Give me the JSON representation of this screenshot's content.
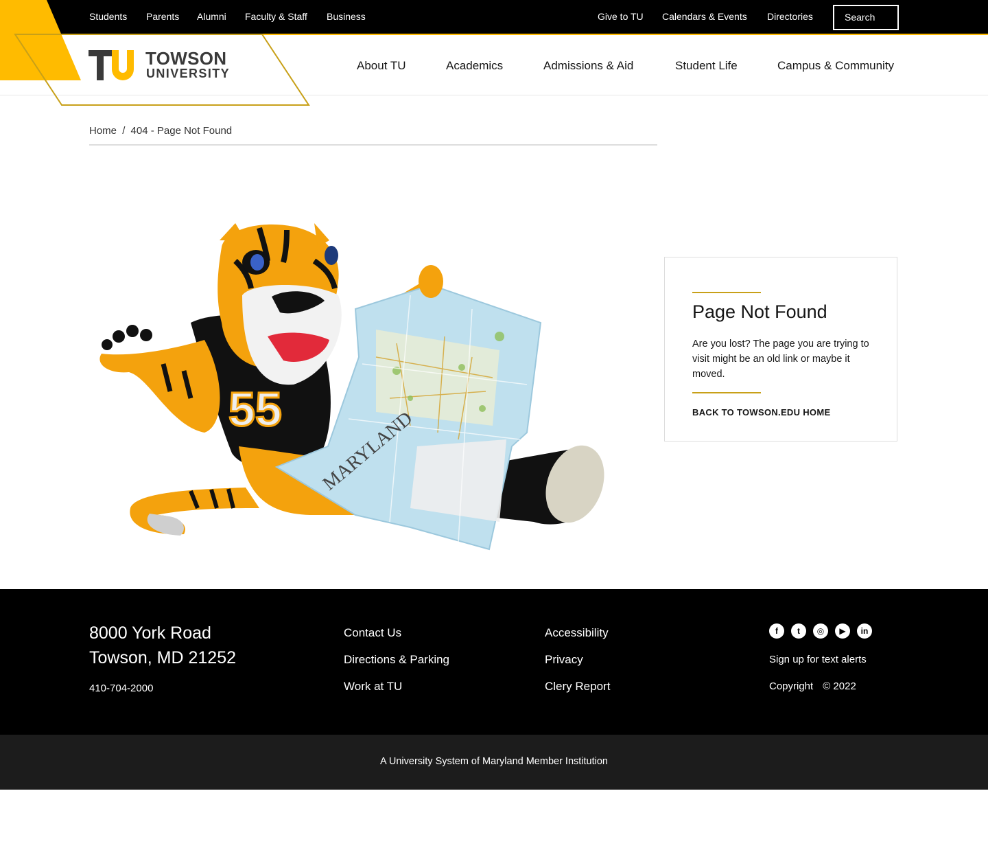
{
  "utility_nav": {
    "left": [
      "Students",
      "Parents",
      "Alumni",
      "Faculty & Staff",
      "Business"
    ],
    "right": [
      "Give to TU",
      "Calendars & Events",
      "Directories"
    ],
    "search_label": "Search"
  },
  "brand": {
    "mark": "TU",
    "name": "TOWSON",
    "sub": "UNIVERSITY",
    "colors": {
      "gold": "#ffbb00",
      "dark": "#3a3a3a",
      "black": "#000000"
    }
  },
  "main_nav": [
    "About TU",
    "Academics",
    "Admissions & Aid",
    "Student Life",
    "Campus & Community"
  ],
  "breadcrumb": {
    "home": "Home",
    "separator": "/",
    "current": "404 - Page Not Found"
  },
  "map_label": "MARYLAND",
  "card": {
    "title": "Page Not Found",
    "body": "Are you lost? The page you are trying to visit might be an old link or maybe it moved.",
    "link": "BACK TO TOWSON.EDU HOME"
  },
  "footer": {
    "address_line1": "8000 York Road",
    "address_line2": "Towson, MD 21252",
    "phone": "410-704-2000",
    "col1": [
      "Contact Us",
      "Directions & Parking",
      "Work at TU"
    ],
    "col2": [
      "Accessibility",
      "Privacy",
      "Clery Report"
    ],
    "social_icons": [
      "facebook-icon",
      "twitter-icon",
      "instagram-icon",
      "youtube-icon",
      "linkedin-icon"
    ],
    "alerts": "Sign up for text alerts",
    "copyright_label": "Copyright",
    "copyright_year": "© 2022"
  },
  "subfooter": "A University System of Maryland Member Institution"
}
